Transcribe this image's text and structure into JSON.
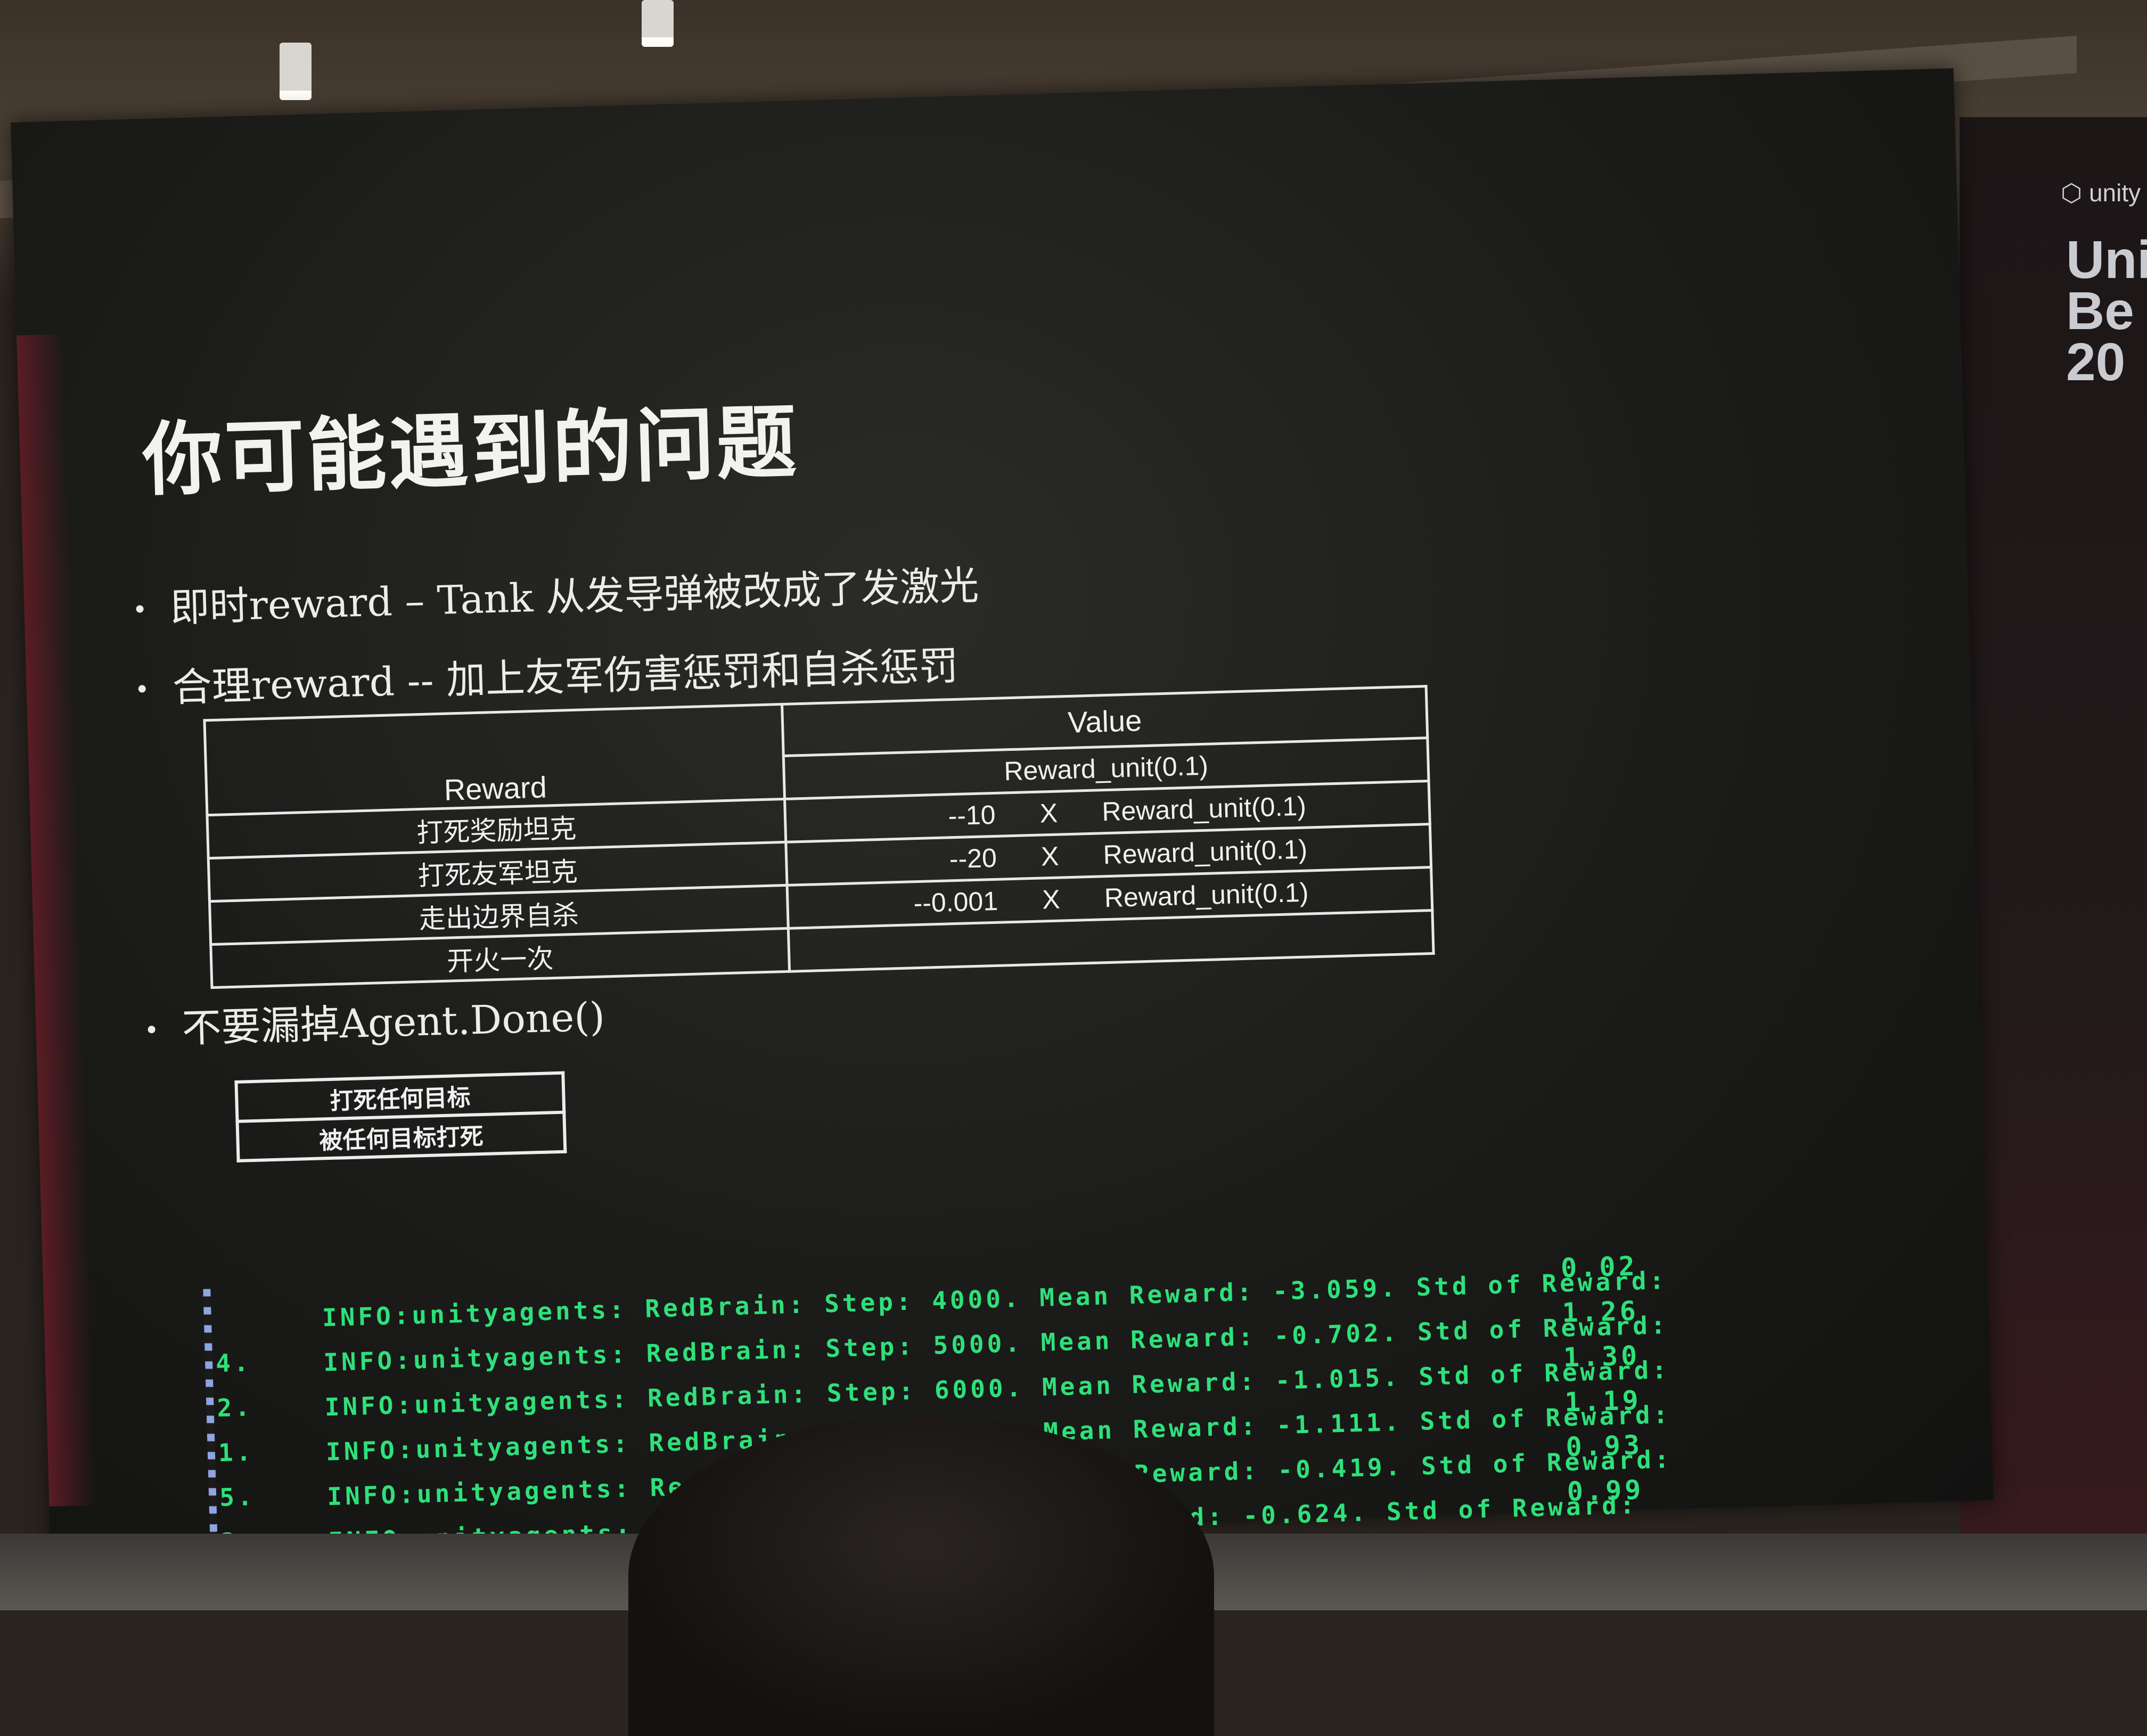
{
  "slide": {
    "title": "你可能遇到的问题",
    "bullets": [
      "即时reward – Tank 从发导弹被改成了发激光",
      "合理reward -- 加上友军伤害惩罚和自杀惩罚",
      "不要漏掉Agent.Done()"
    ]
  },
  "reward_table": {
    "headers": [
      "Reward",
      "Value"
    ],
    "unit_row": "Reward_unit(0.1)",
    "rows": [
      {
        "reward": "打死奖励坦克",
        "mult": "",
        "x": "",
        "unit": ""
      },
      {
        "reward": "打死友军坦克",
        "mult": "--10",
        "x": "X",
        "unit": "Reward_unit(0.1)"
      },
      {
        "reward": "走出边界自杀",
        "mult": "--20",
        "x": "X",
        "unit": "Reward_unit(0.1)"
      },
      {
        "reward": "开火一次",
        "mult": "--0.001",
        "x": "X",
        "unit": "Reward_unit(0.1)"
      }
    ]
  },
  "done_table": [
    "打死任何目标",
    "被任何目标打死"
  ],
  "console": {
    "lines": [
      {
        "head": "INFO:unityagents: RedBrain: Step: 4000. Mean Reward: -3.059. Std of Reward: ",
        "cont": "4.",
        "std": "0.02"
      },
      {
        "head": "INFO:unityagents: RedBrain: Step: 5000. Mean Reward: -0.702. Std of Reward: ",
        "cont": "2.",
        "std": "1.26"
      },
      {
        "head": "INFO:unityagents: RedBrain: Step: 6000. Mean Reward: -1.015. Std of Reward: ",
        "cont": "1.",
        "std": "1.30"
      },
      {
        "head": "INFO:unityagents: RedBrain: Step: 7000. Mean Reward: -1.111. Std of Reward: ",
        "cont": "5.",
        "std": "1.19"
      },
      {
        "head": "INFO:unityagents: RedBrain: Step: 8000. Mean Reward: -0.419. Std of Reward: ",
        "cont": "3.",
        "std": "0.93"
      },
      {
        "head": "INFO:unityagents: RedBrain: Step: 9000.       ard: -0.624. Std of Reward: ",
        "cont": "0.",
        "std": "0.99"
      }
    ]
  },
  "banner": {
    "logo": "unity",
    "title_lines": "Uni\nBe\n20"
  }
}
